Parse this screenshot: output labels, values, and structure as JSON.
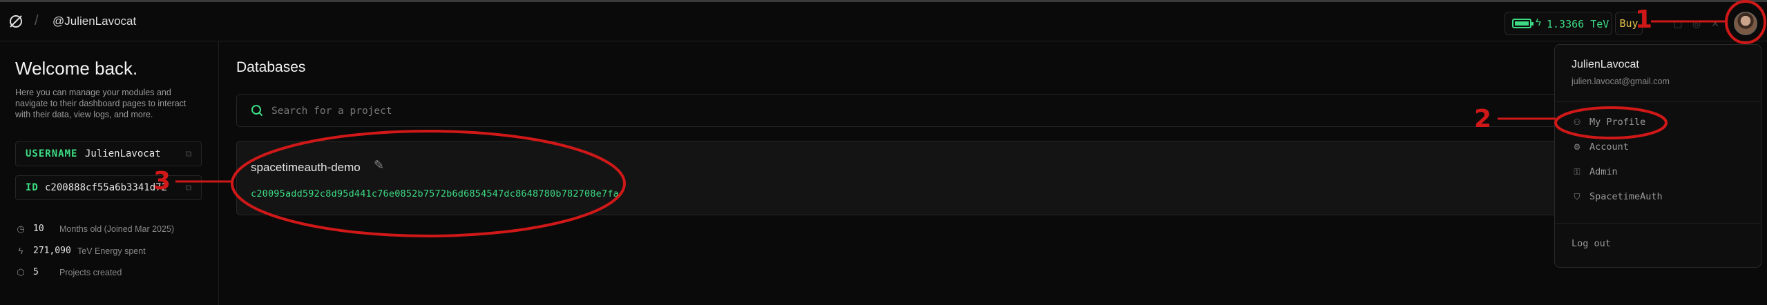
{
  "header": {
    "username_crumb": "@JulienLavocat",
    "energy": "1.3366 TeV",
    "buy_label": "Buy"
  },
  "sidebar": {
    "welcome": "Welcome back.",
    "description": "Here you can manage your modules and navigate to their dashboard pages to interact with their data, view logs, and more.",
    "username_key": "USERNAME",
    "username_value": "JulienLavocat",
    "id_key": "ID",
    "id_value": "c200888cf55a6b3341d72",
    "stats": [
      {
        "icon": "clock-icon",
        "value": "10",
        "label": "Months old (Joined Mar 2025)"
      },
      {
        "icon": "bolt-icon",
        "value": "271,090",
        "label": "TeV Energy spent"
      },
      {
        "icon": "cube-icon",
        "value": "5",
        "label": "Projects created"
      }
    ]
  },
  "main": {
    "title": "Databases",
    "search_placeholder": "Search for a project",
    "projects": [
      {
        "name": "spacetimeauth-demo",
        "hash": "c20095add592c8d95d441c76e0852b7572b6d6854547dc8648780b782708e7fa"
      }
    ]
  },
  "menu": {
    "name": "JulienLavocat",
    "email": "julien.lavocat@gmail.com",
    "items": [
      {
        "icon": "user-icon",
        "label": "My Profile"
      },
      {
        "icon": "gear-icon",
        "label": "Account"
      },
      {
        "icon": "lock-icon",
        "label": "Admin"
      },
      {
        "icon": "shield-icon",
        "label": "SpacetimeAuth"
      }
    ],
    "logout": "Log out"
  },
  "annotations": [
    "1",
    "2",
    "3"
  ],
  "colors": {
    "accent": "#3ddc84",
    "annotation": "#d01818",
    "buy": "#e6c24a"
  }
}
